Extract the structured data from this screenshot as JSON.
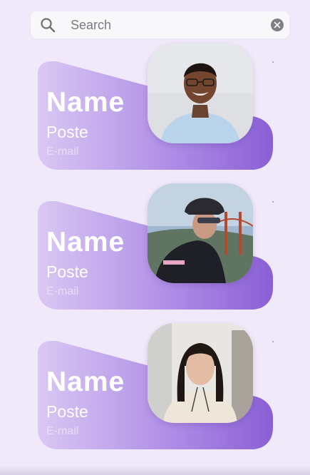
{
  "search": {
    "placeholder": "Search",
    "value": ""
  },
  "cards": [
    {
      "name": "Name",
      "poste": "Poste",
      "email": "E-mail"
    },
    {
      "name": "Name",
      "poste": "Poste",
      "email": "E-mail"
    },
    {
      "name": "Name",
      "poste": "Poste",
      "email": "E-mail"
    }
  ],
  "colors": {
    "background": "#efe9f9",
    "card_gradient_start": "#d7c4f2",
    "card_gradient_end": "#8a5fd6",
    "text": "#ffffff"
  },
  "icons": [
    "search-icon",
    "clear-icon"
  ]
}
